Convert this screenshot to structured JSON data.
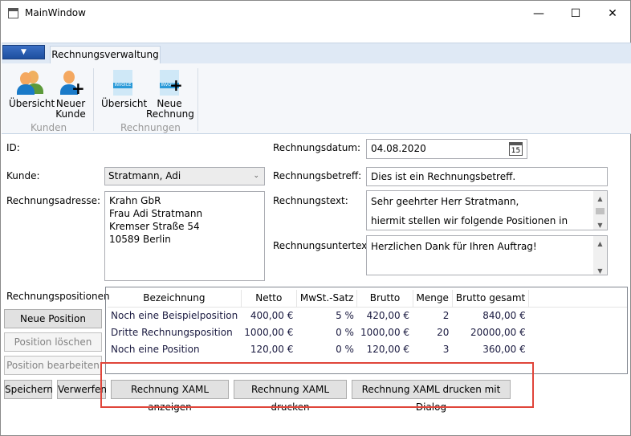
{
  "window": {
    "title": "MainWindow",
    "minimize": "—",
    "maximize": "☐",
    "close": "✕"
  },
  "ribbon": {
    "app_menu_icon": "caret-down",
    "tab": "Rechnungsverwaltung",
    "groups": [
      {
        "label": "Kunden",
        "buttons": [
          {
            "label": "Übersicht"
          },
          {
            "label": "Neuer Kunde"
          }
        ]
      },
      {
        "label": "Rechnungen",
        "buttons": [
          {
            "label": "Übersicht",
            "icon_text": "INVOICE"
          },
          {
            "label": "Neue Rechnung",
            "icon_text": "INVOICE"
          }
        ]
      }
    ]
  },
  "form": {
    "id_label": "ID:",
    "id_value": "",
    "kunde_label": "Kunde:",
    "kunde_value": "Stratmann, Adi",
    "adresse_label": "Rechnungsadresse:",
    "adresse_lines": [
      "Krahn GbR",
      "Frau Adi Stratmann",
      "Kremser Straße 54",
      "10589 Berlin"
    ],
    "datum_label": "Rechnungsdatum:",
    "datum_value": "04.08.2020",
    "calendar_day": "15",
    "betreff_label": "Rechnungsbetreff:",
    "betreff_value": "Dies ist ein Rechnungsbetreff.",
    "text_label": "Rechnungstext:",
    "text_lines": [
      "Sehr geehrter Herr Stratmann,",
      "",
      "hiermit stellen wir folgende Positionen in"
    ],
    "untertext_label": "Rechnungsuntertext:",
    "untertext_value": "Herzlichen Dank für Ihren Auftrag!"
  },
  "positions": {
    "label": "Rechnungspositionen",
    "buttons": {
      "new": "Neue Position",
      "delete": "Position löschen",
      "edit": "Position bearbeiten"
    },
    "columns": [
      "Bezeichnung",
      "Netto",
      "MwSt.-Satz",
      "Brutto",
      "Menge",
      "Brutto gesamt"
    ],
    "rows": [
      [
        "Noch eine Beispielposition",
        "400,00 €",
        "5 %",
        "420,00 €",
        "2",
        "840,00 €"
      ],
      [
        "Dritte Rechnungsposition",
        "1000,00 €",
        "0 %",
        "1000,00 €",
        "20",
        "20000,00 €"
      ],
      [
        "Noch eine Position",
        "120,00 €",
        "0 %",
        "120,00 €",
        "3",
        "360,00 €"
      ]
    ]
  },
  "actions": {
    "save": "Speichern",
    "discard": "Verwerfen",
    "show_xaml": "Rechnung XAML anzeigen",
    "print_xaml": "Rechnung XAML drucken",
    "print_xaml_dialog": "Rechnung XAML drucken mit Dialog"
  },
  "colors": {
    "highlight": "#e0453a",
    "app_menu": "#2a5cb0"
  }
}
